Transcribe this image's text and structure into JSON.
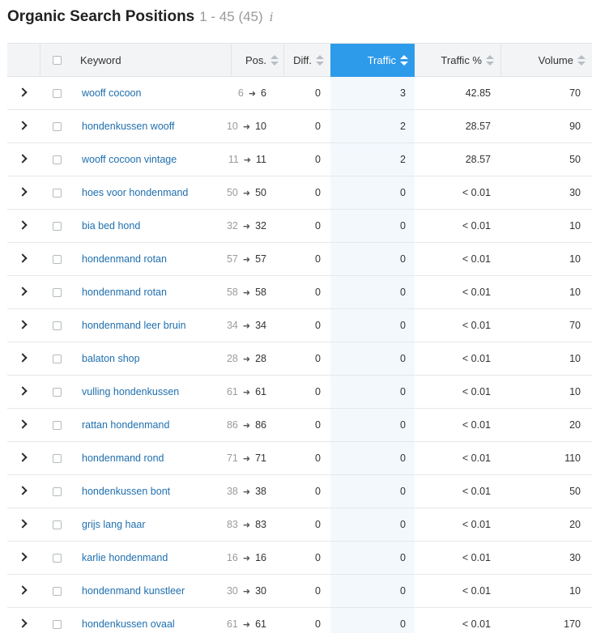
{
  "header": {
    "title": "Organic Search Positions",
    "range": "1 - 45 (45)",
    "info_icon": "i"
  },
  "columns": {
    "keyword": "Keyword",
    "pos": "Pos.",
    "diff": "Diff.",
    "traffic": "Traffic",
    "traffic_pct": "Traffic %",
    "volume": "Volume"
  },
  "colors": {
    "active_sort": "#2e9bea",
    "keyword_link": "#1f6fae",
    "traffic_column_bg": "#f3f8fd"
  },
  "rows": [
    {
      "keyword": "wooff cocoon",
      "pos_prev": "6",
      "pos": "6",
      "diff": "0",
      "traffic": "3",
      "traffic_pct": "42.85",
      "volume": "70"
    },
    {
      "keyword": "hondenkussen wooff",
      "pos_prev": "10",
      "pos": "10",
      "diff": "0",
      "traffic": "2",
      "traffic_pct": "28.57",
      "volume": "90"
    },
    {
      "keyword": "wooff cocoon vintage",
      "pos_prev": "11",
      "pos": "11",
      "diff": "0",
      "traffic": "2",
      "traffic_pct": "28.57",
      "volume": "50"
    },
    {
      "keyword": "hoes voor hondenmand",
      "pos_prev": "50",
      "pos": "50",
      "diff": "0",
      "traffic": "0",
      "traffic_pct": "< 0.01",
      "volume": "30"
    },
    {
      "keyword": "bia bed hond",
      "pos_prev": "32",
      "pos": "32",
      "diff": "0",
      "traffic": "0",
      "traffic_pct": "< 0.01",
      "volume": "10"
    },
    {
      "keyword": "hondenmand rotan",
      "pos_prev": "57",
      "pos": "57",
      "diff": "0",
      "traffic": "0",
      "traffic_pct": "< 0.01",
      "volume": "10"
    },
    {
      "keyword": "hondenmand rotan",
      "pos_prev": "58",
      "pos": "58",
      "diff": "0",
      "traffic": "0",
      "traffic_pct": "< 0.01",
      "volume": "10"
    },
    {
      "keyword": "hondenmand leer bruin",
      "pos_prev": "34",
      "pos": "34",
      "diff": "0",
      "traffic": "0",
      "traffic_pct": "< 0.01",
      "volume": "70"
    },
    {
      "keyword": "balaton shop",
      "pos_prev": "28",
      "pos": "28",
      "diff": "0",
      "traffic": "0",
      "traffic_pct": "< 0.01",
      "volume": "10"
    },
    {
      "keyword": "vulling hondenkussen",
      "pos_prev": "61",
      "pos": "61",
      "diff": "0",
      "traffic": "0",
      "traffic_pct": "< 0.01",
      "volume": "10"
    },
    {
      "keyword": "rattan hondenmand",
      "pos_prev": "86",
      "pos": "86",
      "diff": "0",
      "traffic": "0",
      "traffic_pct": "< 0.01",
      "volume": "20"
    },
    {
      "keyword": "hondenmand rond",
      "pos_prev": "71",
      "pos": "71",
      "diff": "0",
      "traffic": "0",
      "traffic_pct": "< 0.01",
      "volume": "110"
    },
    {
      "keyword": "hondenkussen bont",
      "pos_prev": "38",
      "pos": "38",
      "diff": "0",
      "traffic": "0",
      "traffic_pct": "< 0.01",
      "volume": "50"
    },
    {
      "keyword": "grijs lang haar",
      "pos_prev": "83",
      "pos": "83",
      "diff": "0",
      "traffic": "0",
      "traffic_pct": "< 0.01",
      "volume": "20"
    },
    {
      "keyword": "karlie hondenmand",
      "pos_prev": "16",
      "pos": "16",
      "diff": "0",
      "traffic": "0",
      "traffic_pct": "< 0.01",
      "volume": "30"
    },
    {
      "keyword": "hondenmand kunstleer",
      "pos_prev": "30",
      "pos": "30",
      "diff": "0",
      "traffic": "0",
      "traffic_pct": "< 0.01",
      "volume": "10"
    },
    {
      "keyword": "hondenkussen ovaal",
      "pos_prev": "61",
      "pos": "61",
      "diff": "0",
      "traffic": "0",
      "traffic_pct": "< 0.01",
      "volume": "170"
    }
  ]
}
